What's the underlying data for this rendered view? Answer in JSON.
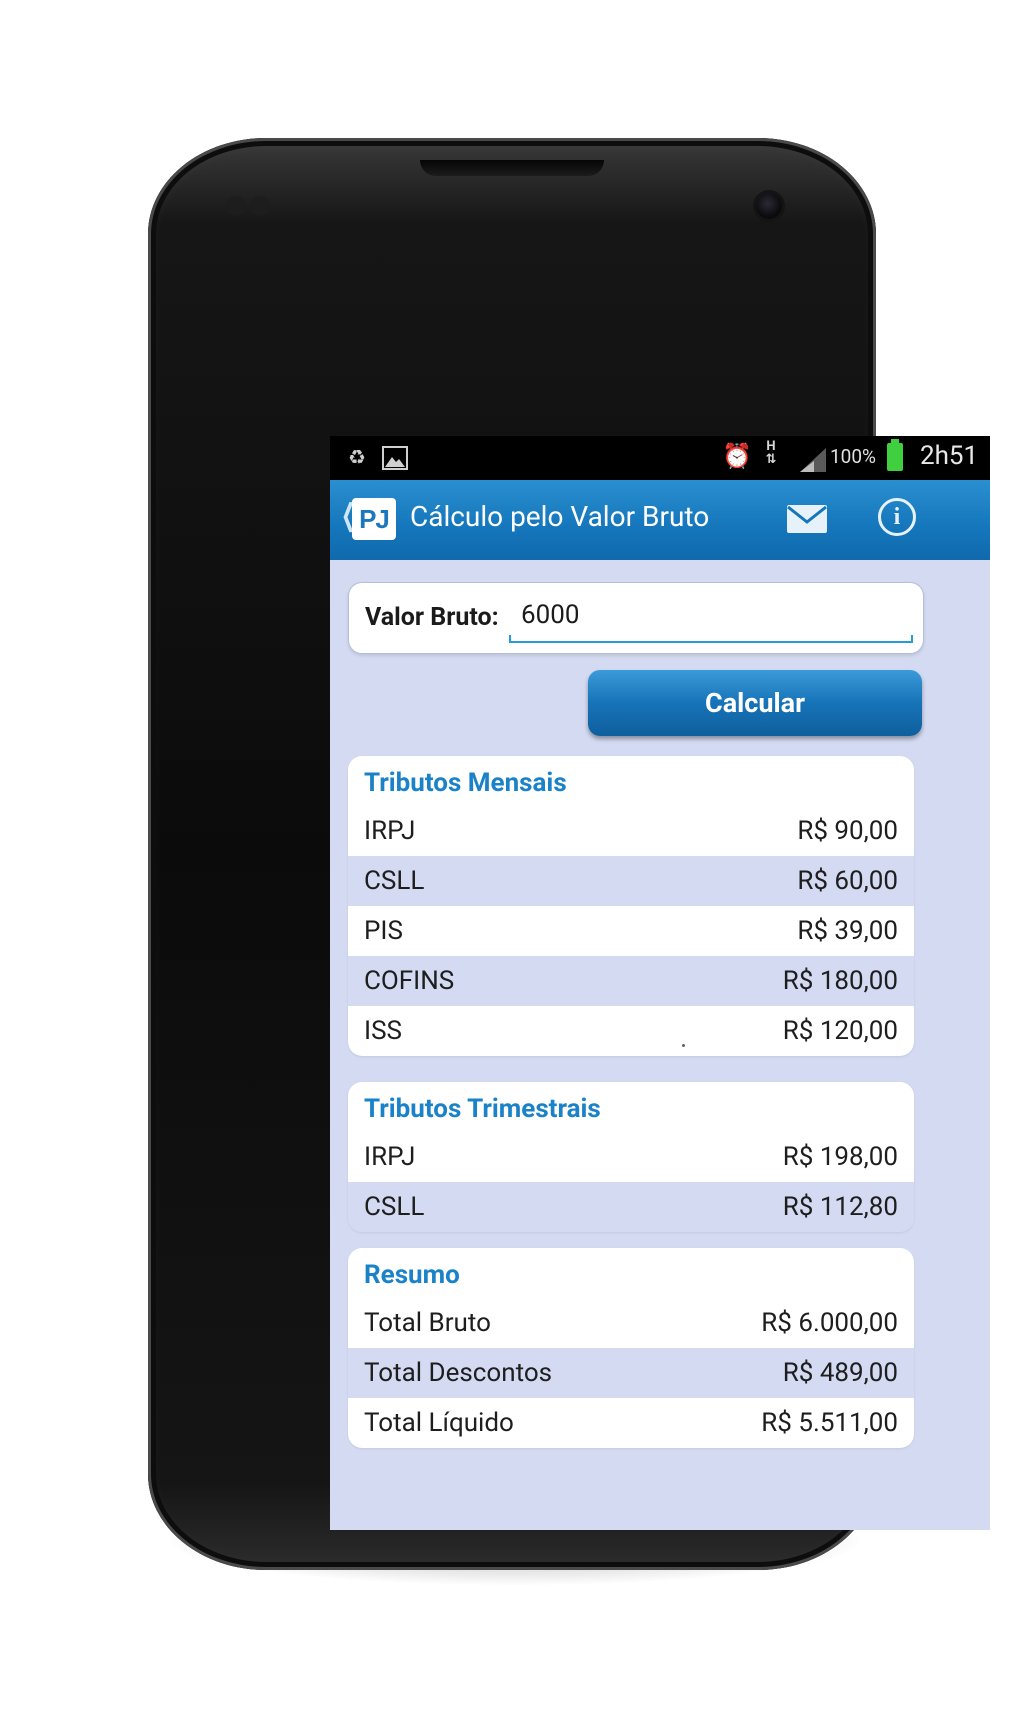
{
  "status_bar": {
    "battery": "100%",
    "network": "H",
    "time": "2h51"
  },
  "action_bar": {
    "logo": "PJ",
    "title": "Cálculo pelo Valor Bruto"
  },
  "form": {
    "label": "Valor Bruto:",
    "value": "6000",
    "button": "Calcular"
  },
  "sections": [
    {
      "title": "Tributos Mensais",
      "rows": [
        {
          "label": "IRPJ",
          "value": "R$ 90,00"
        },
        {
          "label": "CSLL",
          "value": "R$ 60,00"
        },
        {
          "label": "PIS",
          "value": "R$ 39,00"
        },
        {
          "label": "COFINS",
          "value": "R$ 180,00"
        },
        {
          "label": "ISS",
          "value": "R$ 120,00"
        }
      ]
    },
    {
      "title": "Tributos Trimestrais",
      "rows": [
        {
          "label": "IRPJ",
          "value": "R$ 198,00"
        },
        {
          "label": "CSLL",
          "value": "R$ 112,80"
        }
      ]
    },
    {
      "title": "Resumo",
      "rows": [
        {
          "label": "Total Bruto",
          "value": "R$ 6.000,00"
        },
        {
          "label": "Total Descontos",
          "value": "R$ 489,00"
        },
        {
          "label": "Total Líquido",
          "value": "R$ 5.511,00"
        }
      ]
    }
  ],
  "colors": {
    "action_bar": "#1576bb",
    "section_title": "#1a82c8",
    "screen_background": "#d3daf2",
    "battery": "#3fcf3f"
  },
  "icons": [
    "recycle-icon",
    "image-icon",
    "alarm-icon",
    "signal-icon",
    "battery-icon",
    "back-chevron-icon",
    "mail-icon",
    "info-icon"
  ]
}
